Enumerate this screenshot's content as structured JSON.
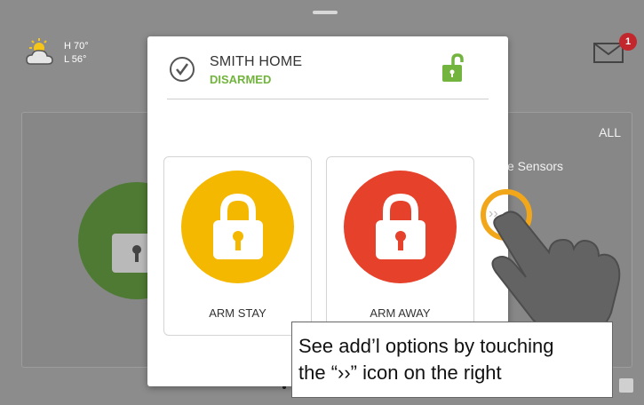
{
  "weather": {
    "high": "H 70°",
    "low": "L 56°",
    "icon": "partly-cloudy-icon"
  },
  "notifications": {
    "count": "1",
    "icon": "mail-icon"
  },
  "background": {
    "filter_label": "ALL",
    "sensors_label": "e Sensors"
  },
  "modal": {
    "system_name": "SMITH HOME",
    "status": "DISARMED",
    "status_color": "#72b43e",
    "buttons": [
      {
        "label": "ARM STAY",
        "color": "#f5b800",
        "icon": "lock-icon"
      },
      {
        "label": "ARM AWAY",
        "color": "#e5412b",
        "icon": "lock-icon"
      }
    ],
    "more_options_icon": "chevron-right-double-icon"
  },
  "tutorial": {
    "caption_line1": "See add’l options by touching",
    "caption_line2": "the “››” icon on the right",
    "highlight_color": "#f2a71b"
  }
}
